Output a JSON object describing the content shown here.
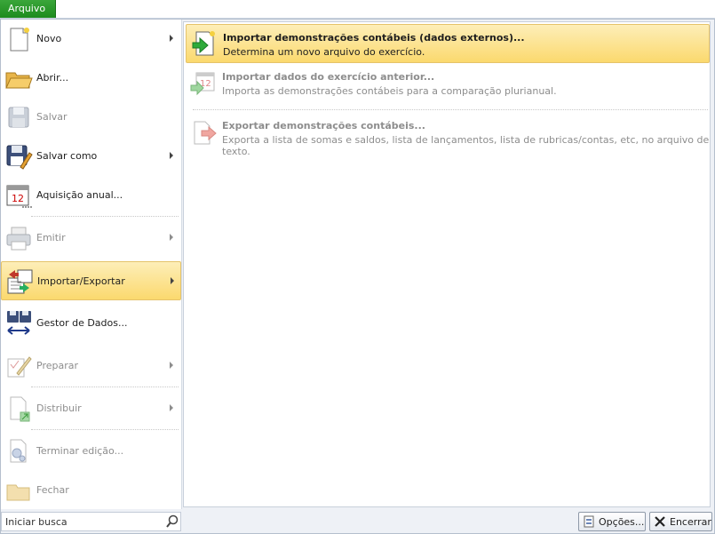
{
  "file_tab": "Arquivo",
  "left_menu": [
    {
      "label": "Novo",
      "icon": "new-document-icon",
      "submenu": true,
      "enabled": true
    },
    {
      "label": "Abrir...",
      "icon": "open-folder-icon",
      "submenu": false,
      "enabled": true
    },
    {
      "label": "Salvar",
      "icon": "save-disk-icon",
      "submenu": false,
      "enabled": false
    },
    {
      "label": "Salvar como",
      "icon": "save-as-icon",
      "submenu": true,
      "enabled": true
    },
    {
      "label": "Aquisição anual...",
      "icon": "calendar-icon",
      "submenu": false,
      "enabled": true
    },
    {
      "label": "Emitir",
      "icon": "printer-icon",
      "submenu": true,
      "enabled": false
    },
    {
      "label": "Importar/Exportar",
      "icon": "import-export-icon",
      "submenu": true,
      "enabled": true,
      "selected": true
    },
    {
      "label": "Gestor de Dados...",
      "icon": "data-manager-icon",
      "submenu": false,
      "enabled": true
    },
    {
      "label": "Preparar",
      "icon": "prepare-pencil-icon",
      "submenu": true,
      "enabled": false
    },
    {
      "label": "Distribuir",
      "icon": "distribute-icon",
      "submenu": true,
      "enabled": false
    },
    {
      "label": "Terminar edição...",
      "icon": "finish-edit-icon",
      "submenu": false,
      "enabled": false
    },
    {
      "label": "Fechar",
      "icon": "close-folder-icon",
      "submenu": false,
      "enabled": false
    }
  ],
  "right_items": [
    {
      "title": "Importar demonstrações contábeis (dados externos)...",
      "desc": "Determina um novo arquivo do exercício.",
      "icon": "import-document-icon",
      "enabled": true,
      "highlighted": true
    },
    {
      "title": "Importar dados do exercício anterior...",
      "desc": "Importa as demonstrações contábeis para a comparação plurianual.",
      "icon": "import-calendar-icon",
      "enabled": false
    },
    {
      "title": "Exportar demonstrações contábeis...",
      "desc": "Exporta a lista de somas e saldos, lista de lançamentos, lista de rubricas/contas, etc, no arquivo de texto.",
      "icon": "export-document-icon",
      "enabled": false
    }
  ],
  "search": {
    "placeholder": "Iniciar busca",
    "icon": "search-icon"
  },
  "buttons": {
    "options": "Opções...",
    "exit": "Encerrar"
  },
  "colors": {
    "file_tab": "#1c8a1c",
    "highlight": "#fbd96e"
  }
}
